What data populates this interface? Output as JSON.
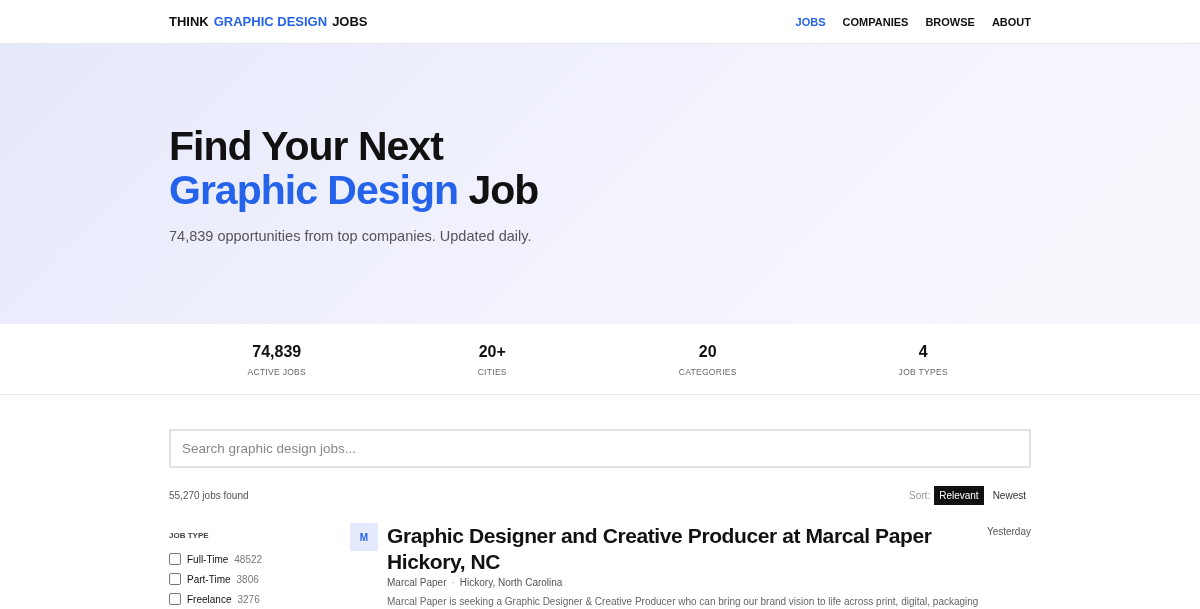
{
  "header": {
    "logo": [
      {
        "text": "THINK",
        "accent": false
      },
      {
        "text": "GRAPHIC DESIGN",
        "accent": true
      },
      {
        "text": "JOBS",
        "accent": false
      }
    ],
    "nav": [
      {
        "label": "JOBS",
        "selected": true
      },
      {
        "label": "COMPANIES",
        "selected": false
      },
      {
        "label": "BROWSE",
        "selected": false
      },
      {
        "label": "ABOUT",
        "selected": false
      }
    ]
  },
  "hero": {
    "title_line_1": "Find Your Next",
    "title_accent": "Graphic Design",
    "title_rest": "Job",
    "subtitle": "74,839 opportunities from top companies. Updated daily."
  },
  "stats": [
    {
      "value": "74,839",
      "label": "ACTIVE JOBS"
    },
    {
      "value": "20+",
      "label": "CITIES"
    },
    {
      "value": "20",
      "label": "CATEGORIES"
    },
    {
      "value": "4",
      "label": "JOB TYPES"
    }
  ],
  "search": {
    "placeholder": "Search graphic design jobs..."
  },
  "results": {
    "count": "55,270 jobs found",
    "sort_label": "Sort:",
    "sort_options": [
      {
        "label": "Relevant",
        "selected": true
      },
      {
        "label": "Newest",
        "selected": false
      }
    ]
  },
  "filters": {
    "heading": "JOB TYPE",
    "items": [
      {
        "label": "Full-Time",
        "count": "48522",
        "checked": false
      },
      {
        "label": "Part-Time",
        "count": "3806",
        "checked": false
      },
      {
        "label": "Freelance",
        "count": "3276",
        "checked": false
      }
    ]
  },
  "jobs": [
    {
      "initial": "M",
      "title": "Graphic Designer and Creative Producer at Marcal Paper Hickory, NC",
      "company": "Marcal Paper",
      "separator": "·",
      "location": "Hickory, North Carolina",
      "posted": "Yesterday",
      "description": "Marcal Paper is seeking a Graphic Designer & Creative Producer who can bring our brand vision to life across print, digital, packaging"
    }
  ]
}
